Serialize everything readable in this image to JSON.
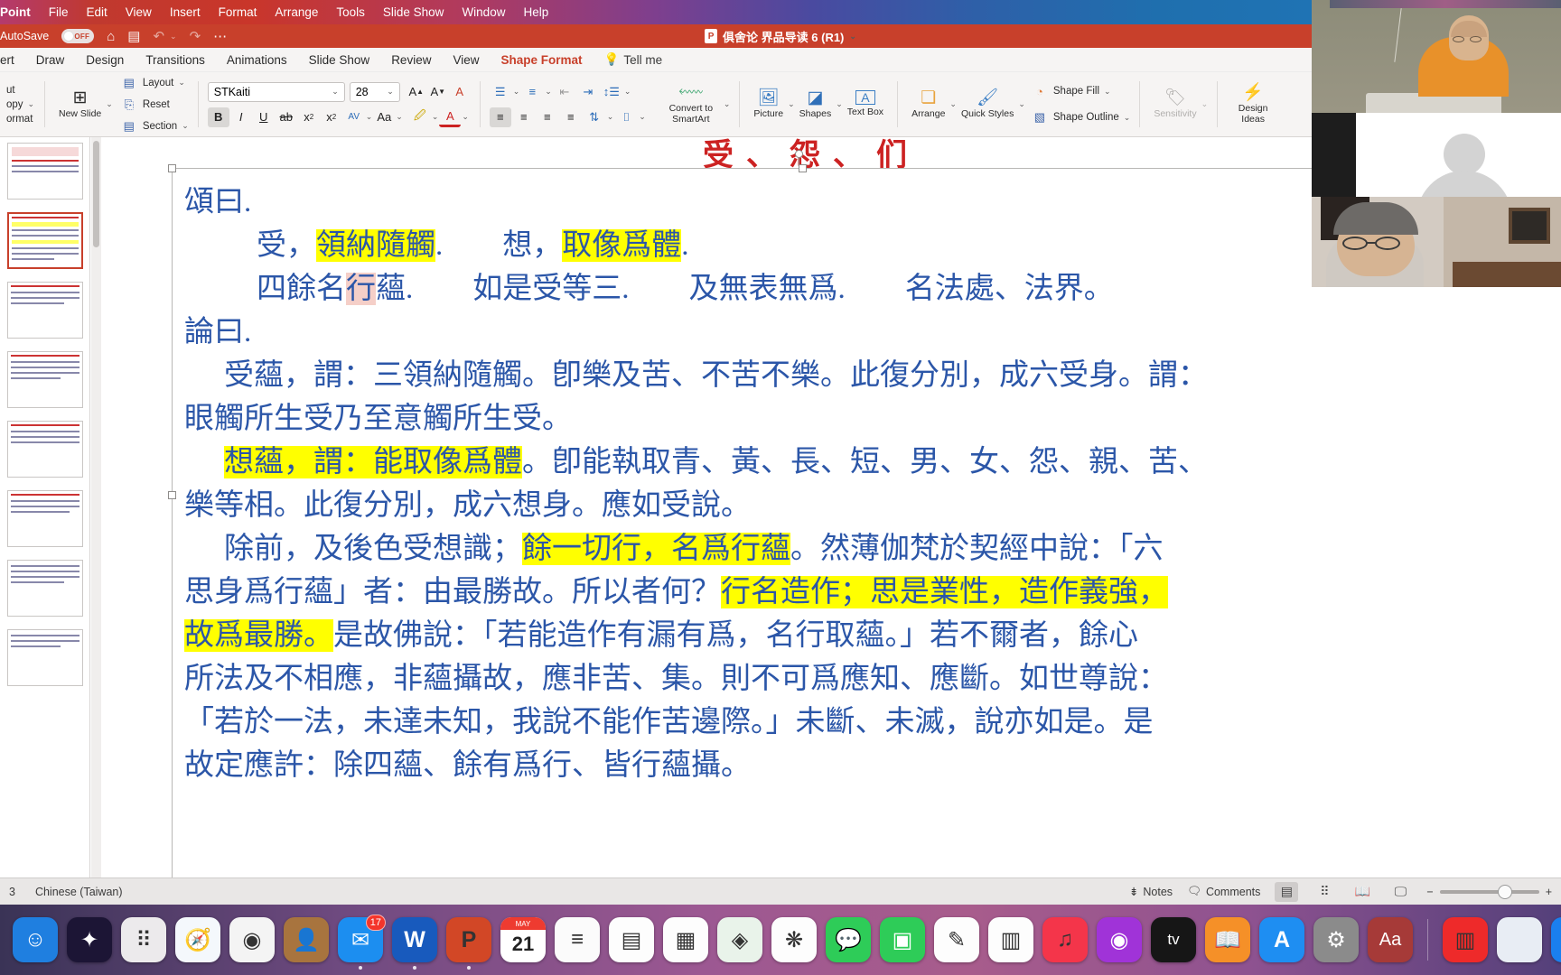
{
  "menubar": {
    "apple": "",
    "items": [
      "Point",
      "File",
      "Edit",
      "View",
      "Insert",
      "Format",
      "Arrange",
      "Tools",
      "Slide Show",
      "Window",
      "Help"
    ],
    "status_icons": [
      "cloud-sync-icon",
      "moon-icon",
      "screen-mirroring-icon",
      "input-source-a-icon",
      "bluetooth-icon",
      "battery-charging-icon",
      "wifi-off-icon",
      "control-center-icon"
    ]
  },
  "titlebar": {
    "autosave_label": "AutoSave",
    "autosave_state": "OFF",
    "document_title": "俱舍论 界品导读 6 (R1)",
    "quick_icons": [
      "home-icon",
      "save-icon",
      "undo-icon",
      "redo-icon",
      "more-icon"
    ]
  },
  "ribbon_tabs": {
    "tabs": [
      "ert",
      "Draw",
      "Design",
      "Transitions",
      "Animations",
      "Slide Show",
      "Review",
      "View",
      "Shape Format"
    ],
    "active": "Shape Format",
    "tell_me": "Tell me"
  },
  "ribbon": {
    "clipboard": {
      "cut": "ut",
      "copy": "opy",
      "format": "ormat"
    },
    "slides": {
      "new_slide": "New Slide",
      "layout": "Layout",
      "reset": "Reset",
      "section": "Section"
    },
    "font": {
      "family": "STKaiti",
      "size": "28",
      "grow": "A",
      "shrink": "A",
      "clear": "A",
      "bold": "B",
      "italic": "I",
      "underline": "U",
      "strikethrough": "ab",
      "superscript": "x",
      "subscript": "x",
      "spacing": "AV",
      "change_case": "Aa",
      "highlight": "highlight-icon",
      "font_color": "A"
    },
    "paragraph": {
      "bullets": "bullets-icon",
      "numbering": "numbering-icon",
      "decrease_indent": "decrease-indent-icon",
      "increase_indent": "increase-indent-icon",
      "line_spacing": "line-spacing-icon",
      "align_left": "align-left-icon",
      "align_center": "align-center-icon",
      "align_right": "align-right-icon",
      "justify": "justify-icon",
      "text_direction": "text-direction-icon",
      "align_text": "align-text-icon",
      "columns": "columns-icon",
      "convert_to_smartart": "Convert to SmartArt"
    },
    "insert": {
      "picture": "Picture",
      "shapes": "Shapes",
      "text_box": "Text Box"
    },
    "arrange": {
      "arrange": "Arrange",
      "quick_styles": "Quick Styles",
      "shape_fill": "Shape Fill",
      "shape_outline": "Shape Outline"
    },
    "sensitivity": "Sensitivity",
    "design_ideas": "Design Ideas"
  },
  "slide": {
    "top_partial_text": "受、怨、们",
    "lines": [
      {
        "id": "l1",
        "indent": 0,
        "segments": [
          {
            "t": "頌曰.",
            "s": "plain"
          }
        ]
      },
      {
        "id": "l2",
        "indent": 80,
        "segments": [
          {
            "t": "受，",
            "s": "plain"
          },
          {
            "t": "領納隨觸",
            "s": "hl"
          },
          {
            "t": ".　　想，",
            "s": "plain"
          },
          {
            "t": "取像爲體",
            "s": "hl"
          },
          {
            "t": ".",
            "s": "plain"
          }
        ]
      },
      {
        "id": "l3",
        "indent": 80,
        "segments": [
          {
            "t": "四餘名",
            "s": "plain"
          },
          {
            "t": "行",
            "s": "sel"
          },
          {
            "t": "蘊.　　如是受等三.　　及無表無爲.　　名法處、法界。",
            "s": "plain"
          }
        ]
      },
      {
        "id": "l4",
        "indent": 0,
        "segments": [
          {
            "t": "論曰.",
            "s": "plain"
          }
        ]
      },
      {
        "id": "l5",
        "indent": 44,
        "segments": [
          {
            "t": "受蘊，謂：三領納隨觸。卽樂及苦、不苦不樂。此復分別，成六受身。謂：",
            "s": "plain"
          }
        ]
      },
      {
        "id": "l6",
        "indent": 0,
        "segments": [
          {
            "t": "眼觸所生受乃至意觸所生受。",
            "s": "plain"
          }
        ]
      },
      {
        "id": "l7",
        "indent": 44,
        "segments": [
          {
            "t": "想蘊，謂：能取像爲體",
            "s": "hl"
          },
          {
            "t": "。卽能執取青、黃、長、短、男、女、怨、親、苦、",
            "s": "plain"
          }
        ]
      },
      {
        "id": "l8",
        "indent": 0,
        "segments": [
          {
            "t": "樂等相。此復分別，成六想身。應如受說。",
            "s": "plain"
          }
        ]
      },
      {
        "id": "l9",
        "indent": 44,
        "segments": [
          {
            "t": "除前，及後色受想識；",
            "s": "plain"
          },
          {
            "t": "餘一切行，名爲行蘊",
            "s": "hl"
          },
          {
            "t": "。然薄伽梵於契經中說：「六",
            "s": "plain"
          }
        ]
      },
      {
        "id": "l10",
        "indent": 0,
        "segments": [
          {
            "t": "思身爲行蘊」者：由最勝故。所以者何？",
            "s": "plain"
          },
          {
            "t": "行名造作；思是業性，造作義強，",
            "s": "hl"
          }
        ]
      },
      {
        "id": "l11",
        "indent": 0,
        "segments": [
          {
            "t": "故爲最勝。",
            "s": "hl"
          },
          {
            "t": "是故佛說：「若能造作有漏有爲，名行取蘊。」若不爾者，餘心",
            "s": "plain"
          }
        ]
      },
      {
        "id": "l12",
        "indent": 0,
        "segments": [
          {
            "t": "所法及不相應，非蘊攝故，應非苦、集。則不可爲應知、應斷。如世尊說：",
            "s": "plain"
          }
        ]
      },
      {
        "id": "l13",
        "indent": 0,
        "segments": [
          {
            "t": "「若於一法，未達未知，我說不能作苦邊際。」未斷、未滅，說亦如是。是",
            "s": "plain"
          }
        ]
      },
      {
        "id": "l14",
        "indent": 0,
        "segments": [
          {
            "t": "故定應許：除四蘊、餘有爲行、皆行蘊攝。",
            "s": "plain"
          }
        ]
      }
    ]
  },
  "statusbar": {
    "slide_number": "3",
    "language": "Chinese (Taiwan)",
    "notes": "Notes",
    "comments": "Comments",
    "views": [
      "normal-view-icon",
      "slide-sorter-icon",
      "reading-view-icon",
      "presenter-view-icon"
    ],
    "zoom_minus": "−",
    "zoom_plus": "+"
  },
  "dock": {
    "items": [
      {
        "name": "finder",
        "glyph": "☺",
        "bg": "#1f7fe0",
        "dot": false
      },
      {
        "name": "siri",
        "glyph": "✦",
        "bg": "#1c1535",
        "dot": false
      },
      {
        "name": "launchpad",
        "glyph": "⠿",
        "bg": "#eceaec",
        "dot": false
      },
      {
        "name": "safari",
        "glyph": "🧭",
        "bg": "#f4f8fc",
        "dot": false
      },
      {
        "name": "chrome",
        "glyph": "◉",
        "bg": "#f4f4f4",
        "dot": false
      },
      {
        "name": "contacts",
        "glyph": "👤",
        "bg": "#a8743e",
        "dot": false
      },
      {
        "name": "mail",
        "glyph": "✉",
        "bg": "#1c8ef0",
        "dot": true,
        "badge": "17"
      },
      {
        "name": "word",
        "glyph": "W",
        "bg": "#185abd",
        "dot": true
      },
      {
        "name": "powerpoint",
        "glyph": "P",
        "bg": "#d24726",
        "dot": true
      },
      {
        "name": "calendar",
        "glyph": "21",
        "bg": "#ffffff",
        "dot": false,
        "sub": "MAY"
      },
      {
        "name": "reminders",
        "glyph": "≡",
        "bg": "#fbfbfb",
        "dot": false
      },
      {
        "name": "notes",
        "glyph": "▤",
        "bg": "#fdfdfd",
        "dot": false
      },
      {
        "name": "numbers",
        "glyph": "▦",
        "bg": "#fdfdfd",
        "dot": false
      },
      {
        "name": "maps",
        "glyph": "◈",
        "bg": "#e9f3ea",
        "dot": false
      },
      {
        "name": "photos",
        "glyph": "❋",
        "bg": "#fdfdfd",
        "dot": false
      },
      {
        "name": "messages",
        "glyph": "💬",
        "bg": "#2ecc58",
        "dot": false
      },
      {
        "name": "facetime",
        "glyph": "▣",
        "bg": "#2ecc58",
        "dot": false
      },
      {
        "name": "pages",
        "glyph": "✎",
        "bg": "#fdfdfd",
        "dot": false
      },
      {
        "name": "keynote",
        "glyph": "▥",
        "bg": "#fdfdfd",
        "dot": false
      },
      {
        "name": "music",
        "glyph": "♫",
        "bg": "#f4354a",
        "dot": false
      },
      {
        "name": "podcasts",
        "glyph": "◉",
        "bg": "#a033d8",
        "dot": false
      },
      {
        "name": "apple-tv",
        "glyph": "tv",
        "bg": "#161616",
        "dot": false
      },
      {
        "name": "books",
        "glyph": "📖",
        "bg": "#f59028",
        "dot": false
      },
      {
        "name": "app-store",
        "glyph": "A",
        "bg": "#1e8ef2",
        "dot": false
      },
      {
        "name": "system-settings",
        "glyph": "⚙",
        "bg": "#8b8b8b",
        "dot": false
      },
      {
        "name": "dictionary",
        "glyph": "Aa",
        "bg": "#a63a38",
        "dot": false
      },
      {
        "name": "separator",
        "glyph": "",
        "bg": "",
        "dot": false
      },
      {
        "name": "audio-app",
        "glyph": "▥",
        "bg": "#ee2a2a",
        "dot": false
      },
      {
        "name": "blank-window",
        "glyph": "",
        "bg": "#e8edf4",
        "dot": false
      },
      {
        "name": "zoom",
        "glyph": "▣",
        "bg": "#1a7fef",
        "dot": true
      }
    ]
  },
  "colors": {
    "accent_red": "#c8402b",
    "text_blue": "#2b56a8",
    "highlight_yellow": "#ffff00",
    "selection_pink": "#f5cfc8"
  }
}
